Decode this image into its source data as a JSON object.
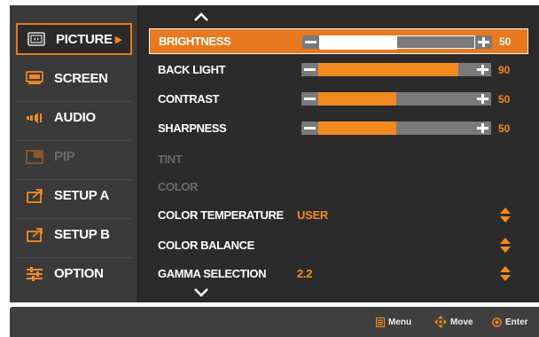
{
  "sidebar": {
    "items": [
      {
        "label": "PICTURE",
        "icon": "picture-icon",
        "active": true
      },
      {
        "label": "SCREEN",
        "icon": "screen-icon"
      },
      {
        "label": "AUDIO",
        "icon": "audio-icon"
      },
      {
        "label": "PIP",
        "icon": "pip-icon",
        "disabled": true
      },
      {
        "label": "SETUP A",
        "icon": "setup-icon"
      },
      {
        "label": "SETUP B",
        "icon": "setup-icon"
      },
      {
        "label": "OPTION",
        "icon": "option-icon"
      }
    ],
    "active_arrow": "▶"
  },
  "menu": {
    "rows": [
      {
        "label": "BRIGHTNESS",
        "type": "slider",
        "value": 50,
        "level": 0.5,
        "selected": true
      },
      {
        "label": "BACK LIGHT",
        "type": "slider",
        "value": 90,
        "level": 0.9
      },
      {
        "label": "CONTRAST",
        "type": "slider",
        "value": 50,
        "level": 0.5
      },
      {
        "label": "SHARPNESS",
        "type": "slider",
        "value": 50,
        "level": 0.5
      },
      {
        "label": "TINT",
        "type": "disabled"
      },
      {
        "label": "COLOR",
        "type": "disabled"
      },
      {
        "label": "COLOR TEMPERATURE",
        "type": "option",
        "value": "USER"
      },
      {
        "label": "COLOR BALANCE",
        "type": "option",
        "value": ""
      },
      {
        "label": "GAMMA SELECTION",
        "type": "option",
        "value": "2.2"
      }
    ]
  },
  "footer": {
    "menu_label": "Menu",
    "move_label": "Move",
    "enter_label": "Enter"
  },
  "colors": {
    "accent": "#f38a20",
    "highlight": "#e8791e",
    "panel": "#2b2b2b",
    "sidebar": "#3a3a3a"
  }
}
